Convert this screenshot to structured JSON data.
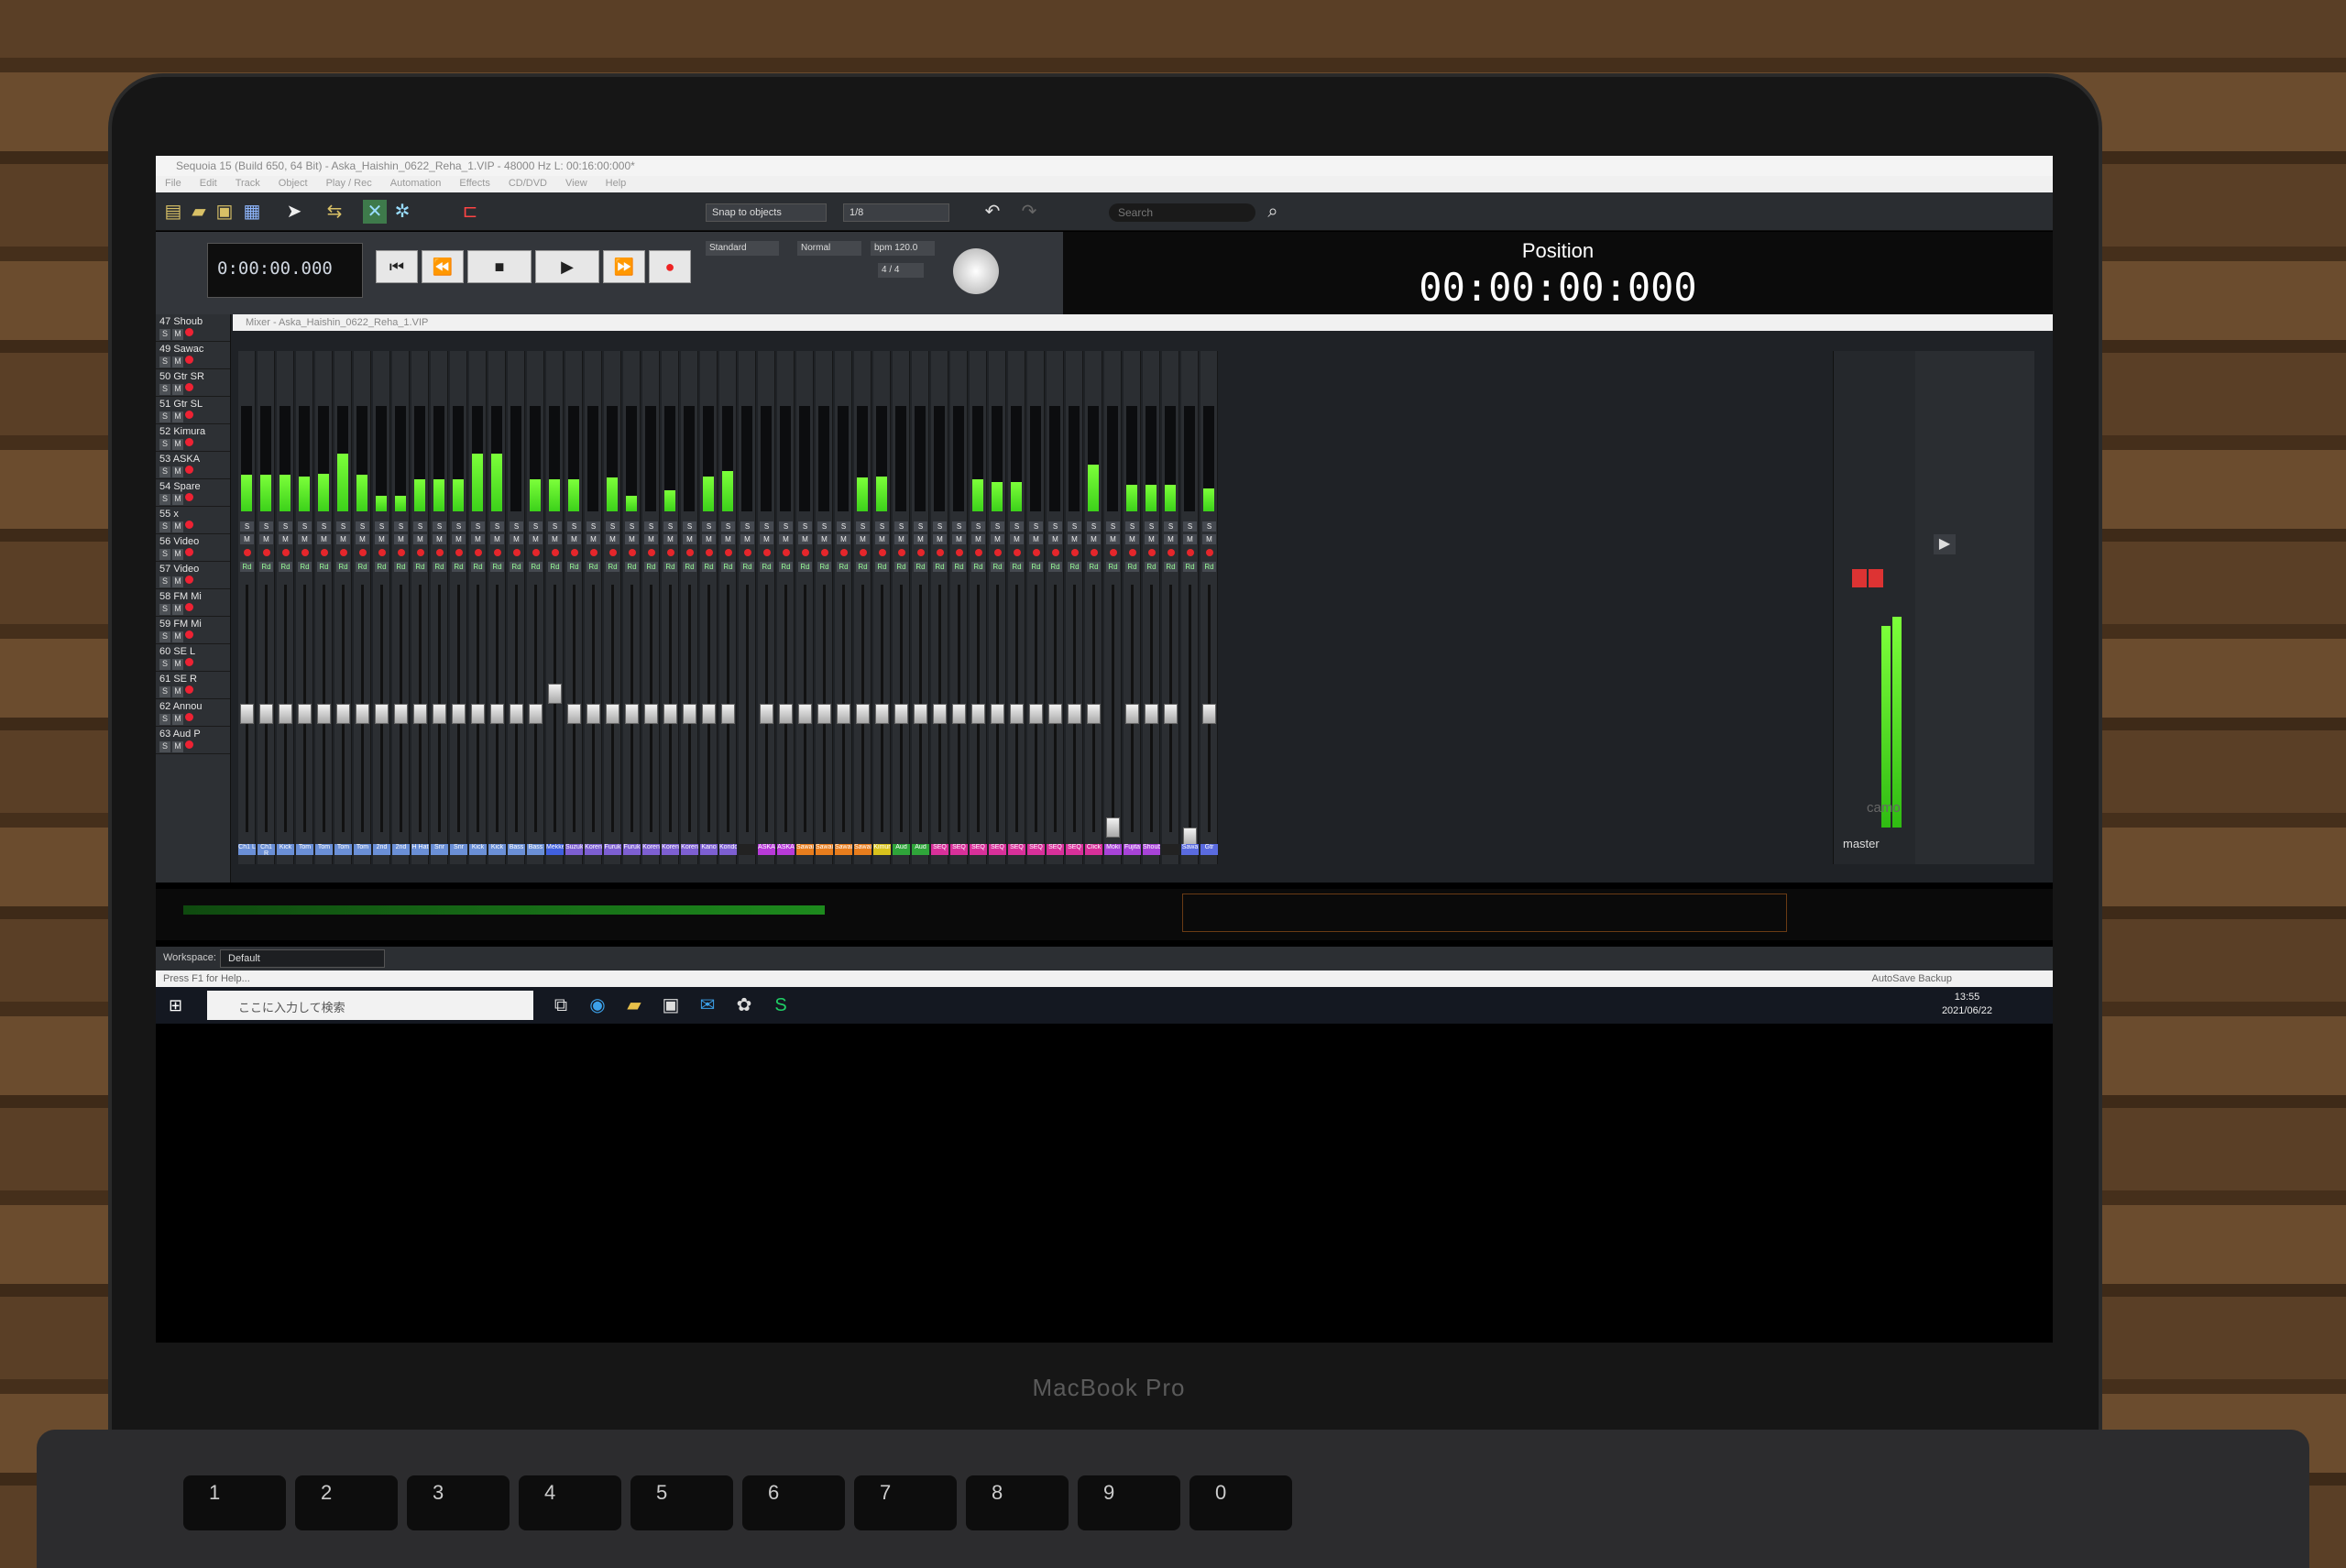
{
  "window": {
    "title": "Sequoia 15 (Build 650, 64 Bit) - Aska_Haishin_0622_Reha_1.VIP - 48000 Hz L: 00:16:00:000*",
    "menus": [
      "File",
      "Edit",
      "Track",
      "Object",
      "Play / Rec",
      "Automation",
      "Effects",
      "CD/DVD",
      "View",
      "Help"
    ]
  },
  "toolbar": {
    "snap": "Snap to objects",
    "quantize": "1/8",
    "search_placeholder": "Search"
  },
  "transport": {
    "counter": "0:00:00.000",
    "mode": "Standard",
    "play_mode": "Normal",
    "tempo": "bpm 120.0",
    "signature": "4 / 4"
  },
  "position": {
    "label": "Position",
    "value": "00:00:00:000"
  },
  "mixer": {
    "title": "Mixer - Aska_Haishin_0622_Reha_1.VIP",
    "tracks": [
      {
        "num": "47",
        "name": "Shoub"
      },
      {
        "num": "49",
        "name": "Sawac"
      },
      {
        "num": "50",
        "name": "Gtr SR"
      },
      {
        "num": "51",
        "name": "Gtr SL"
      },
      {
        "num": "52",
        "name": "Kimura"
      },
      {
        "num": "53",
        "name": "ASKA"
      },
      {
        "num": "54",
        "name": "Spare"
      },
      {
        "num": "55",
        "name": "x"
      },
      {
        "num": "56",
        "name": "Video"
      },
      {
        "num": "57",
        "name": "Video"
      },
      {
        "num": "58",
        "name": "FM Mi"
      },
      {
        "num": "59",
        "name": "FM Mi"
      },
      {
        "num": "60",
        "name": "SE L"
      },
      {
        "num": "61",
        "name": "SE R"
      },
      {
        "num": "62",
        "name": "Annou"
      },
      {
        "num": "63",
        "name": "Aud P"
      }
    ],
    "channel_names": [
      "Ch1 L",
      "Ch1 R",
      "Kick",
      "Tom",
      "Tom",
      "Tom",
      "Tom",
      "2nd",
      "2nd",
      "H Hat",
      "Snr",
      "Snr",
      "Kick",
      "Kick",
      "Bass",
      "Bass",
      "Mekke",
      "Suzuk",
      "Koren",
      "Furuk",
      "Furuk",
      "Koren",
      "Koren",
      "Koren",
      "Kano",
      "Kondo",
      "",
      "ASKA",
      "ASKA",
      "Sawai",
      "Sawai",
      "Sawai",
      "Sawai",
      "Kimur",
      "Aud",
      "Aud",
      "SEQ",
      "SEQ",
      "SEQ",
      "SEQ",
      "SEQ",
      "SEQ",
      "SEQ",
      "SEQ",
      "Click",
      "Moki",
      "Fujita",
      "Shoub",
      "",
      "Sawa",
      "Gtr"
    ],
    "master_label": "master",
    "brand": "camo"
  },
  "workspace": {
    "label": "Workspace:",
    "value": "Default"
  },
  "status": {
    "help": "Press F1 for Help...",
    "autosave": "AutoSave Backup"
  },
  "taskbar": {
    "search": "ここに入力して検索",
    "time": "13:55",
    "date": "2021/06/22"
  },
  "device": {
    "label": "MacBook Pro"
  },
  "keyboard": [
    "1",
    "2",
    "3",
    "4",
    "5",
    "6",
    "7",
    "8",
    "9",
    "0"
  ],
  "colors": {
    "meter_green": "#7cff3a",
    "record_red": "#e5262b",
    "bg": "#1f2226"
  }
}
